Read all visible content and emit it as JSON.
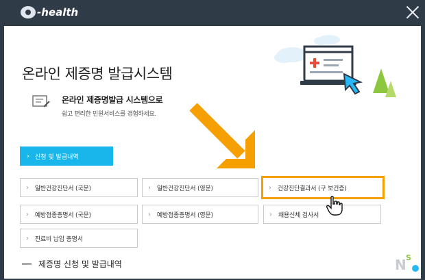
{
  "app": {
    "name": "-health"
  },
  "page": {
    "title": "온라인 제증명 발급시스템"
  },
  "intro": {
    "heading": "온라인 제증명발급 시스템으로",
    "subtext": "쉽고 편리한 민원서비스를 경험하세요."
  },
  "primary_button": {
    "label": "신청 및 발급내역"
  },
  "options": [
    {
      "label": "일반건강진단서 (국문)"
    },
    {
      "label": "일반건강진단서 (영문)"
    },
    {
      "label": "건강진단결과서 (구 보건증)"
    },
    {
      "label": "예방접종증명서 (국문)"
    },
    {
      "label": "예방접종증명서 (영문)"
    },
    {
      "label": "채용신체 검사서"
    },
    {
      "label": "진료비 납입 증명서"
    }
  ],
  "section": {
    "title": "제증명 신청 및 발급내역"
  },
  "colors": {
    "titlebar": "#2f3b47",
    "accent": "#18b6ea",
    "highlight": "#f5a000",
    "hero_green": "#8dc63f"
  },
  "icons": [
    "logo-icon",
    "close-icon",
    "document-edit-icon",
    "monitor-plus-icon",
    "arrow-icon",
    "hand-cursor-icon",
    "chevron-right-icon"
  ]
}
